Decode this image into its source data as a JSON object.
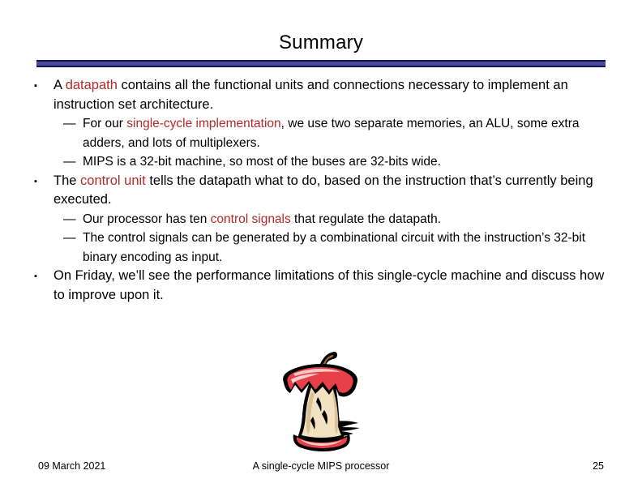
{
  "slide": {
    "title": "Summary",
    "accent_bar_fill": "#4a4a9c",
    "accent_bar_border": "#121258",
    "highlight_color": "#b02b2b",
    "background": "#ffffff"
  },
  "content": {
    "bullets": [
      {
        "level": 1,
        "marker": "square-bullet",
        "marker_glyph": "▪",
        "segments": [
          {
            "text": "A ",
            "highlight": false
          },
          {
            "text": "datapath",
            "highlight": true
          },
          {
            "text": " contains all the functional units and connections necessary to implement an instruction set architecture.",
            "highlight": false
          }
        ]
      },
      {
        "level": 2,
        "marker": "em-dash-bullet",
        "marker_glyph": "—",
        "segments": [
          {
            "text": "For our ",
            "highlight": false
          },
          {
            "text": "single-cycle implementation",
            "highlight": true
          },
          {
            "text": ", we use two separate memories, an ALU, some extra adders, and lots of multiplexers.",
            "highlight": false
          }
        ]
      },
      {
        "level": 2,
        "marker": "em-dash-bullet",
        "marker_glyph": "—",
        "segments": [
          {
            "text": "MIPS is a 32-bit machine, so most of the buses are 32-bits wide.",
            "highlight": false
          }
        ]
      },
      {
        "level": 1,
        "marker": "square-bullet",
        "marker_glyph": "▪",
        "segments": [
          {
            "text": "The ",
            "highlight": false
          },
          {
            "text": "control unit",
            "highlight": true
          },
          {
            "text": " tells the datapath what to do, based on the instruction that’s currently being executed.",
            "highlight": false
          }
        ]
      },
      {
        "level": 2,
        "marker": "em-dash-bullet",
        "marker_glyph": "—",
        "segments": [
          {
            "text": "Our processor has ten ",
            "highlight": false
          },
          {
            "text": "control signals",
            "highlight": true
          },
          {
            "text": " that regulate the datapath.",
            "highlight": false
          }
        ]
      },
      {
        "level": 2,
        "marker": "em-dash-bullet",
        "marker_glyph": "—",
        "segments": [
          {
            "text": "The control signals can be generated by a combinational circuit with the instruction’s 32-bit binary encoding as input.",
            "highlight": false
          }
        ]
      },
      {
        "level": 1,
        "marker": "square-bullet",
        "marker_glyph": "▪",
        "segments": [
          {
            "text": "On Friday, we’ll see the performance limitations of this single-cycle machine and discuss how to improve upon it.",
            "highlight": false
          }
        ]
      }
    ]
  },
  "image": {
    "name": "apple-core-clipart",
    "alt": "Apple core",
    "colors": {
      "outline": "#000000",
      "skin": "#e8404a",
      "skin_light": "#f5a0a0",
      "flesh": "#f2e2c2",
      "flesh_shade": "#d9c097",
      "stem": "#9c6134",
      "shadow": "#000000"
    }
  },
  "footer": {
    "date": "09 March 2021",
    "center_text": "A single-cycle MIPS processor",
    "page_number": "25"
  }
}
